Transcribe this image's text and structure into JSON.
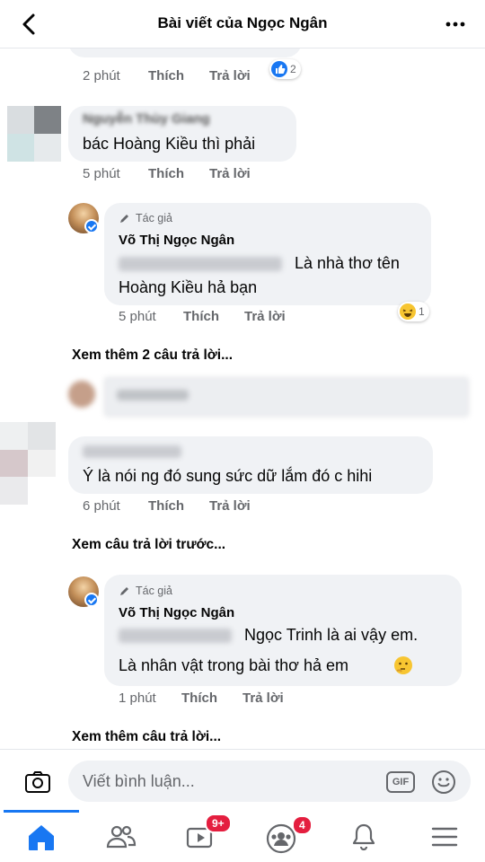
{
  "header": {
    "title": "Bài viết của Ngọc Ngân"
  },
  "comments": [
    {
      "time": "2 phút",
      "like": "Thích",
      "reply": "Trả lời",
      "reaction_count": "2"
    },
    {
      "name_partial": "Nguyễn Thùy Giang",
      "text_partial": "bác Hoàng Kiều thì phải",
      "time_partial": "5 phút",
      "like": "Thích",
      "reply": "Trả lời"
    },
    {
      "author_badge": "Tác giả",
      "name": "Võ Thị Ngọc Ngân",
      "text_line1": "Là nhà thơ tên",
      "text_line2": "Hoàng Kiều hả bạn",
      "time": "5 phút",
      "like": "Thích",
      "reply": "Trả lời",
      "reaction_count": "1"
    },
    {
      "text": "Ý là nói ng đó sung sức dữ lắm đó c hihi",
      "time": "6 phút",
      "like": "Thích",
      "reply": "Trả lời"
    },
    {
      "author_badge": "Tác giả",
      "name": "Võ Thị Ngọc Ngân",
      "text_line1": "Ngọc Trinh là ai vậy em.",
      "text_line2": "Là nhân vật trong bài thơ hả em",
      "time": "1 phút",
      "like": "Thích",
      "reply": "Trả lời"
    }
  ],
  "links": {
    "more_replies_2": "Xem thêm 2 câu trả lời...",
    "previous_replies": "Xem câu trả lời trước...",
    "more_replies": "Xem thêm câu trả lời..."
  },
  "composer": {
    "placeholder": "Viết bình luận...",
    "gif_label": "GIF"
  },
  "tabbar": {
    "watch_badge": "9+",
    "groups_badge": "4"
  },
  "colors": {
    "accent": "#1877f2",
    "bubble": "#f0f2f5",
    "meta": "#65676b",
    "badge": "#e41e3f"
  }
}
